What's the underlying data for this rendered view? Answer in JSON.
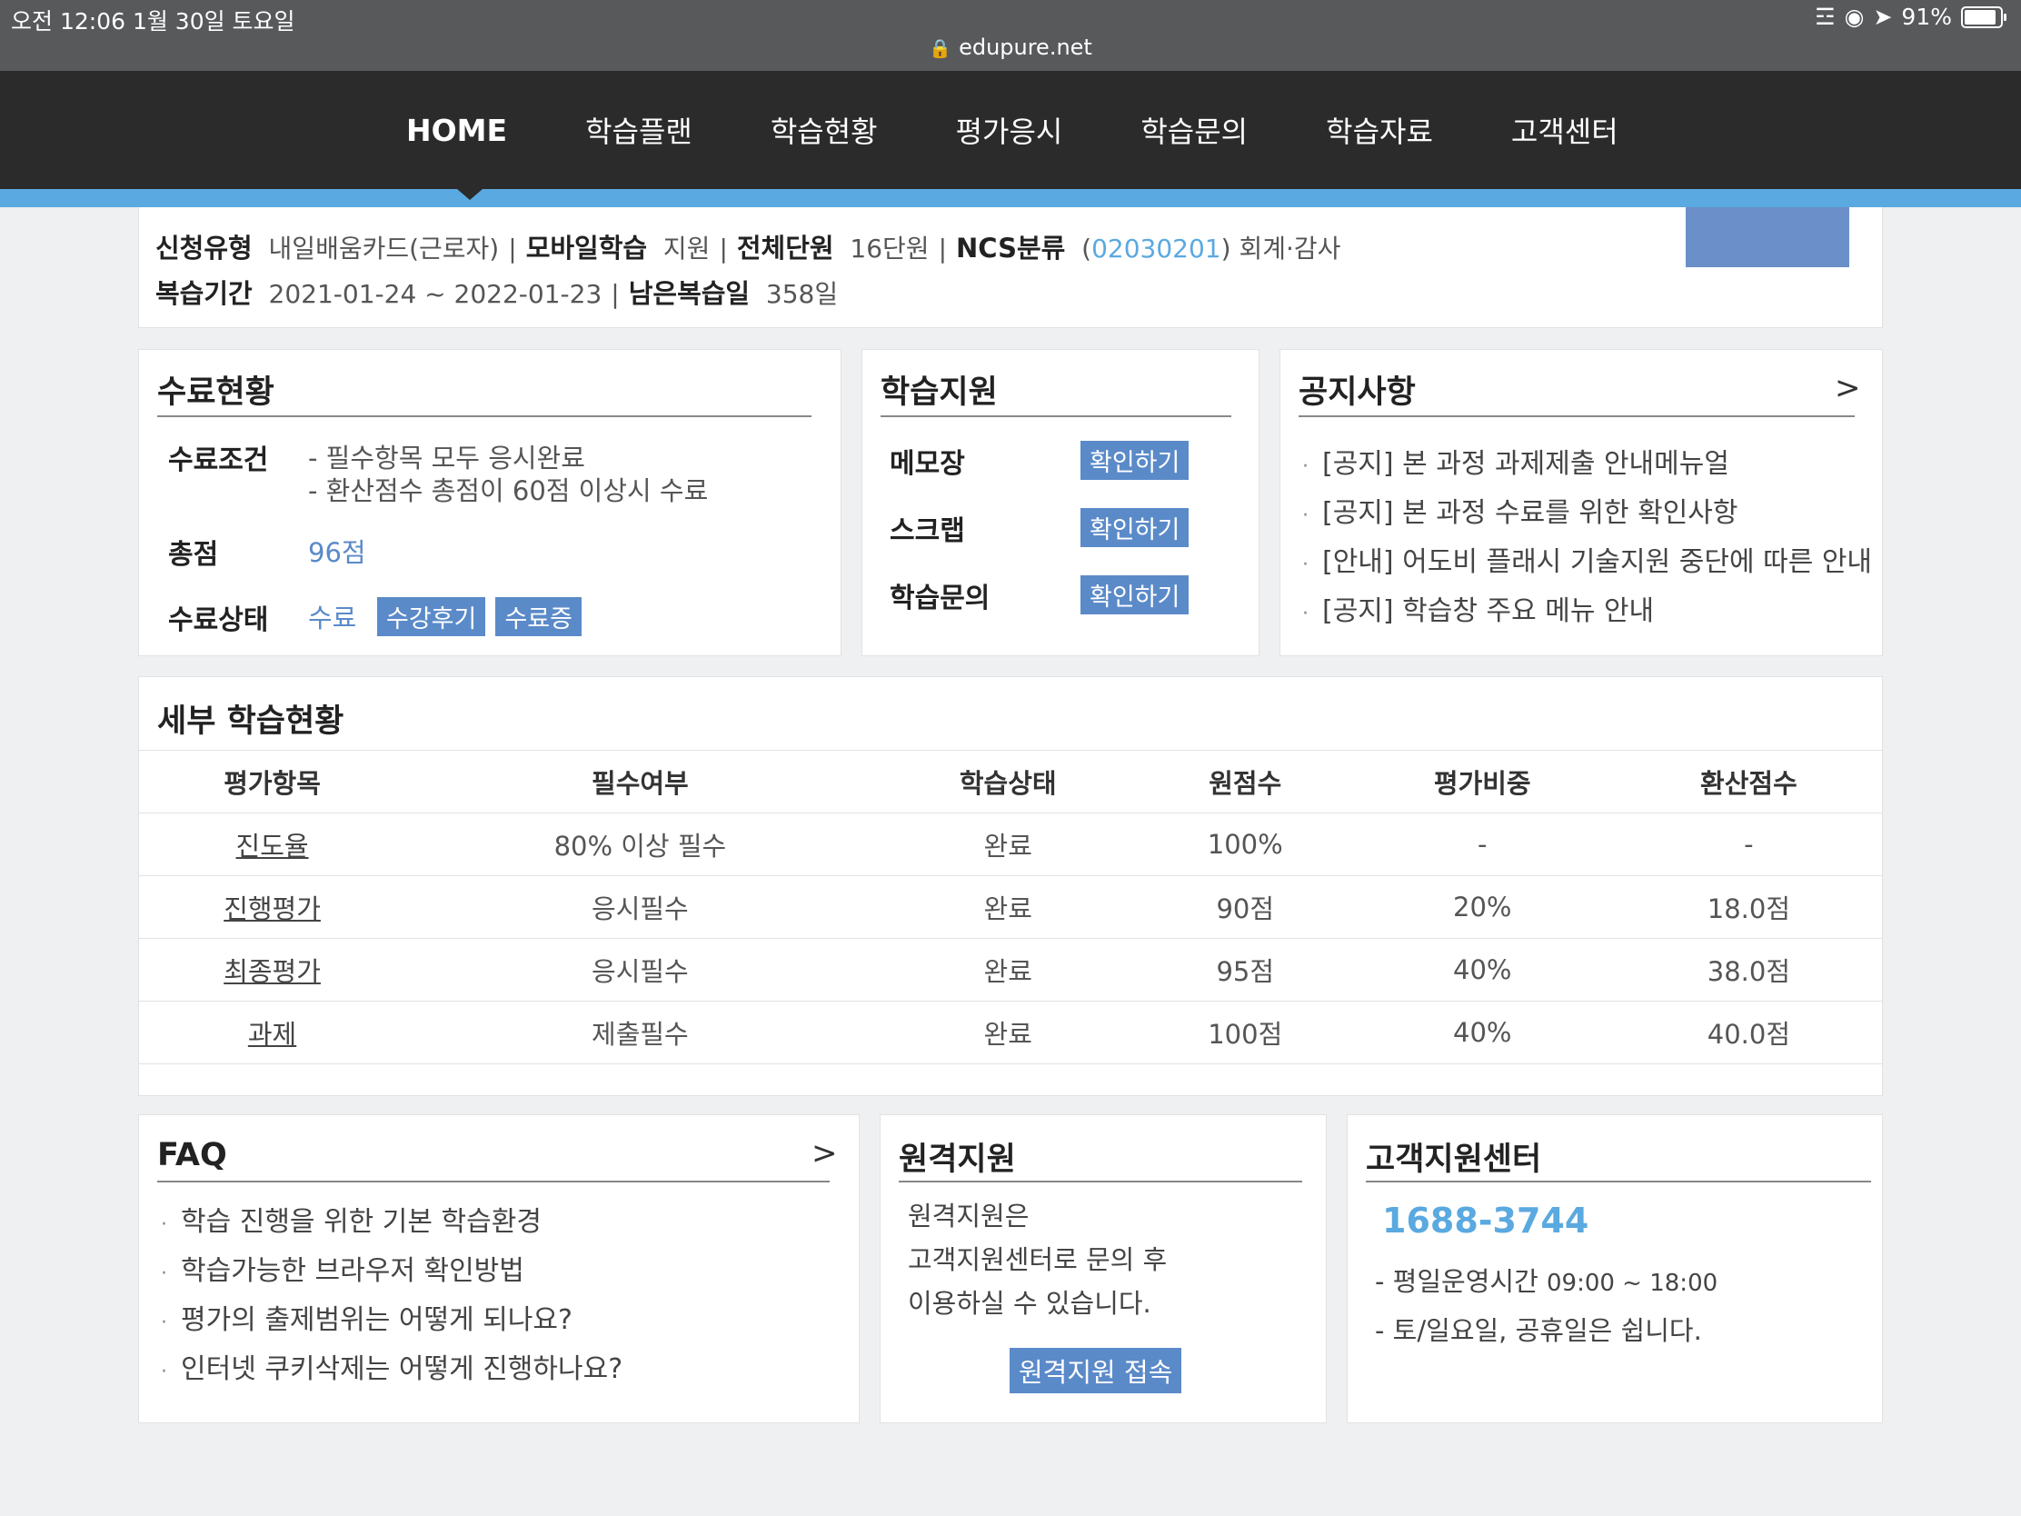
{
  "statusbar": {
    "time": "오전 12:06   1월 30일 토요일",
    "url": "edupure.net",
    "battery": "91%"
  },
  "nav": {
    "items": [
      "HOME",
      "학습플랜",
      "학습현황",
      "평가응시",
      "학습문의",
      "학습자료",
      "고객센터"
    ]
  },
  "info": {
    "row1": {
      "type_label": "신청유형",
      "type_value": "내일배움카드(근로자)",
      "mode_label": "모바일학습",
      "mode_value": "지원",
      "units_label": "전체단원",
      "units_value": "16단원",
      "ncs_label": "NCS분류",
      "ncs_paren_open": "(",
      "ncs_code": "02030201",
      "ncs_paren_close": ")",
      "ncs_value": "회계·감사"
    },
    "row2": {
      "review_label": "복습기간",
      "review_value": "2021-01-24 ~ 2022-01-23",
      "remain_label": "남은복습일",
      "remain_value": "358일"
    }
  },
  "completion": {
    "title": "수료현황",
    "condition_label": "수료조건",
    "condition_lines": [
      "- 필수항목 모두 응시완료",
      "- 환산점수 총점이 60점 이상시 수료"
    ],
    "total_label": "총점",
    "total_value": "96점",
    "status_label": "수료상태",
    "status_value": "수료",
    "review_button": "수강후기",
    "certificate_button": "수료증"
  },
  "support": {
    "title": "학습지원",
    "items": [
      {
        "label": "메모장",
        "button": "확인하기"
      },
      {
        "label": "스크랩",
        "button": "확인하기"
      },
      {
        "label": "학습문의",
        "button": "확인하기"
      }
    ]
  },
  "notice": {
    "title": "공지사항",
    "more": ">",
    "items": [
      "[공지] 본 과정 과제제출 안내메뉴얼",
      "[공지] 본 과정 수료를 위한 확인사항",
      "[안내] 어도비 플래시 기술지원 중단에 따른 안내",
      "[공지] 학습창 주요 메뉴 안내"
    ]
  },
  "detail": {
    "title": "세부 학습현황",
    "headers": [
      "평가항목",
      "필수여부",
      "학습상태",
      "원점수",
      "평가비중",
      "환산점수"
    ],
    "rows": [
      [
        "진도율",
        "80% 이상 필수",
        "완료",
        "100%",
        "-",
        "-"
      ],
      [
        "진행평가",
        "응시필수",
        "완료",
        "90점",
        "20%",
        "18.0점"
      ],
      [
        "최종평가",
        "응시필수",
        "완료",
        "95점",
        "40%",
        "38.0점"
      ],
      [
        "과제",
        "제출필수",
        "완료",
        "100점",
        "40%",
        "40.0점"
      ]
    ]
  },
  "faq": {
    "title": "FAQ",
    "more": ">",
    "items": [
      "학습 진행을 위한 기본 학습환경",
      "학습가능한 브라우저 확인방법",
      "평가의 출제범위는 어떻게 되나요?",
      "인터넷 쿠키삭제는 어떻게 진행하나요?"
    ]
  },
  "remote": {
    "title": "원격지원",
    "lines": [
      "원격지원은",
      "고객지원센터로 문의 후",
      "이용하실 수 있습니다."
    ],
    "button": "원격지원 접속"
  },
  "cs": {
    "title": "고객지원센터",
    "phone": "1688-3744",
    "hours_label": "- 평일운영시간",
    "hours_value": "09:00 ~ 18:00",
    "holiday": "- 토/일요일, 공휴일은 쉽니다."
  },
  "colors": {
    "accent": "#5aa9e0",
    "button": "#5b8ac9",
    "nav_bg": "#2b2b2b",
    "status_bg": "#58595b"
  }
}
